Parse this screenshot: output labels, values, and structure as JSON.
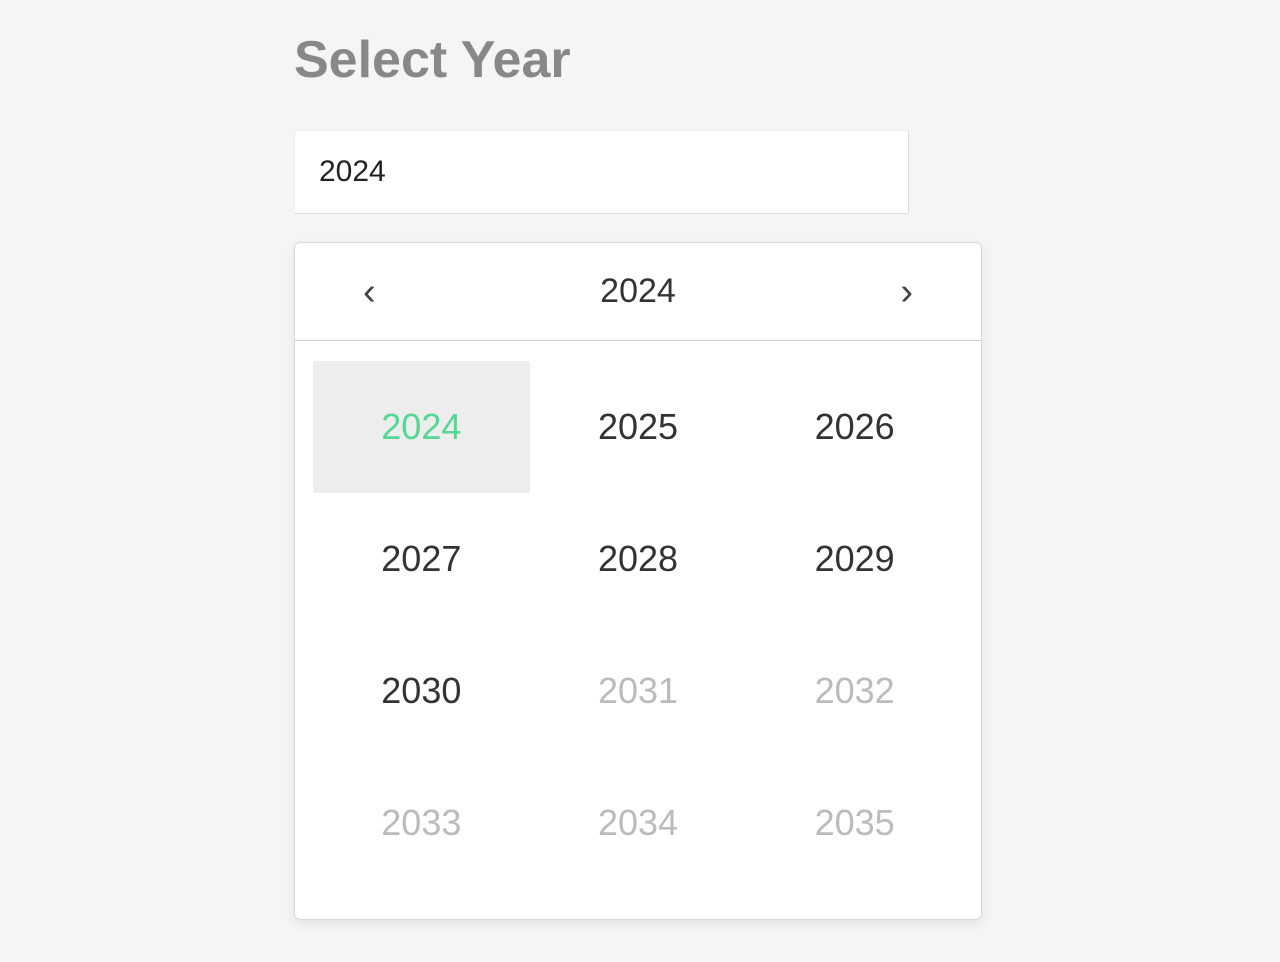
{
  "title": "Select Year",
  "input": {
    "value": "2024"
  },
  "picker": {
    "header_year": "2024",
    "prev_glyph": "‹",
    "next_glyph": "›",
    "years": [
      {
        "label": "2024",
        "selected": true,
        "disabled": false
      },
      {
        "label": "2025",
        "selected": false,
        "disabled": false
      },
      {
        "label": "2026",
        "selected": false,
        "disabled": false
      },
      {
        "label": "2027",
        "selected": false,
        "disabled": false
      },
      {
        "label": "2028",
        "selected": false,
        "disabled": false
      },
      {
        "label": "2029",
        "selected": false,
        "disabled": false
      },
      {
        "label": "2030",
        "selected": false,
        "disabled": false
      },
      {
        "label": "2031",
        "selected": false,
        "disabled": true
      },
      {
        "label": "2032",
        "selected": false,
        "disabled": true
      },
      {
        "label": "2033",
        "selected": false,
        "disabled": true
      },
      {
        "label": "2034",
        "selected": false,
        "disabled": true
      },
      {
        "label": "2035",
        "selected": false,
        "disabled": true
      }
    ]
  }
}
